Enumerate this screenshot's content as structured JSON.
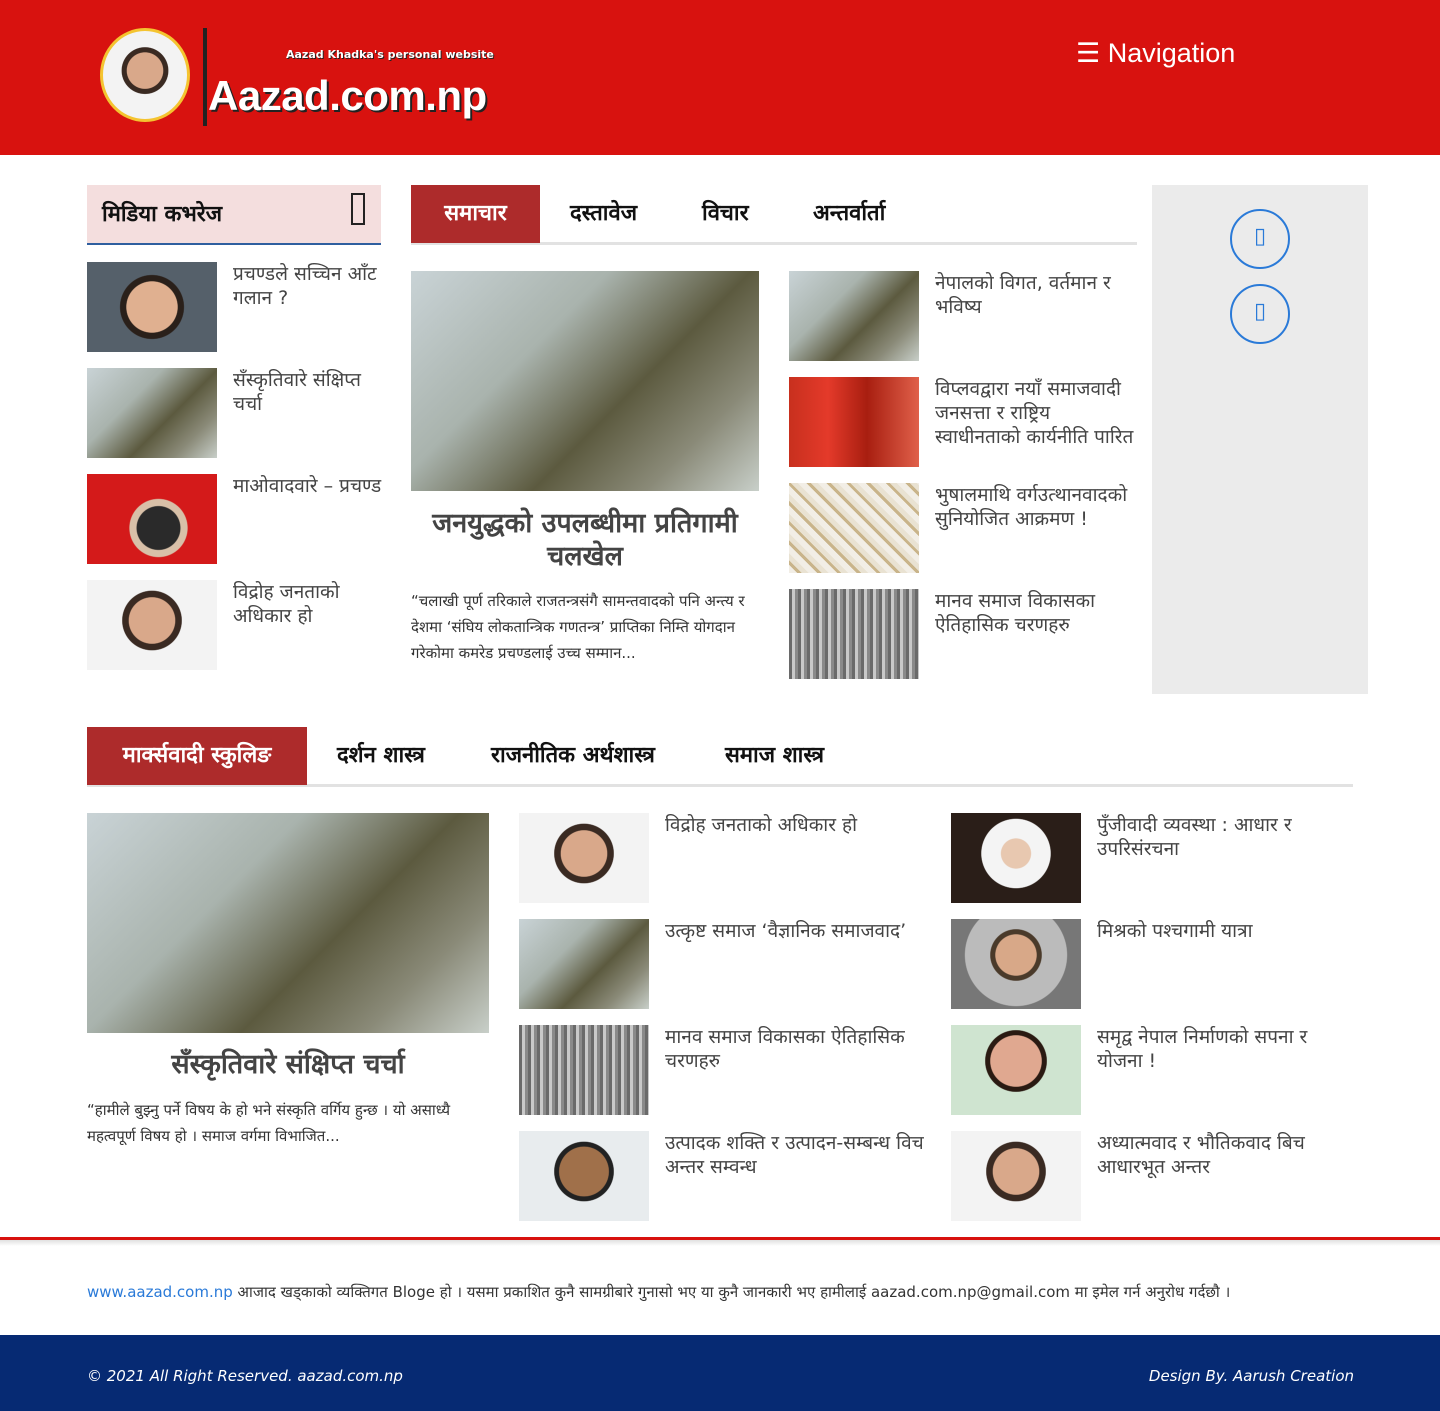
{
  "header": {
    "logo_subtitle": "Aazad Khadka's personal website",
    "logo_title": "Aazad.com.np",
    "nav_label": "☰ Navigation"
  },
  "sidebar": {
    "title": "मिडिया कभरेज",
    "items": [
      {
        "title": "प्रचण्डले सच्चिन आँट गलान ?"
      },
      {
        "title": "सँस्कृतिवारे संक्षिप्त चर्चा"
      },
      {
        "title": "माओवादवारे – प्रचण्ड"
      },
      {
        "title": "विद्रोह जनताको अधिकार हो"
      }
    ]
  },
  "news_tabs": {
    "tabs": [
      "समाचार",
      "दस्तावेज",
      "विचार",
      "अन्तर्वार्ता"
    ],
    "featured": {
      "title": "जनयुद्धको उपलब्धीमा प्रतिगामी चलखेल",
      "excerpt": "“चलाखी पूर्ण तरिकाले राजतन्त्रसंगै सामन्तवादको पनि अन्त्य र देशमा ‘संघिय लोकतान्त्रिक गणतन्त्र’ प्राप्तिका निम्ति योगदान गरेकोमा कमरेड प्रचण्डलाई उच्च सम्मान..."
    },
    "items": [
      {
        "title": "नेपालको विगत, वर्तमान र भविष्य"
      },
      {
        "title": "विप्लवद्वारा नयाँ समाजवादी जनसत्ता र राष्ट्रिय स्वाधीनताको कार्यनीति पारित"
      },
      {
        "title": "भुषालमाथि वर्गउत्थानवादको सुनियोजित आक्रमण !"
      },
      {
        "title": "मानव समाज विकासका ऐतिहासिक चरणहरु"
      }
    ]
  },
  "social": {
    "icons": [
      "facebook-icon",
      "twitter-icon"
    ],
    "glyph": "▯"
  },
  "schooling": {
    "tabs": [
      "मार्क्सवादी स्कुलिङ",
      "दर्शन शास्त्र",
      "राजनीतिक अर्थशास्त्र",
      "समाज शास्त्र"
    ],
    "featured": {
      "title": "सँस्कृतिवारे संक्षिप्त चर्चा",
      "excerpt": "“हामीले बुझ्नु पर्ने विषय के हो भने संस्कृति वर्गिय हुन्छ । यो असाध्यै महत्वपूर्ण विषय हो । समाज वर्गमा विभाजित..."
    },
    "col1": [
      {
        "title": "विद्रोह जनताको अधिकार हो"
      },
      {
        "title": "उत्कृष्ट समाज ‘वैज्ञानिक समाजवाद’"
      },
      {
        "title": "मानव समाज विकासका ऐतिहासिक चरणहरु"
      },
      {
        "title": "उत्पादक शक्ति र उत्पादन-सम्बन्ध विच अन्तर सम्वन्ध"
      }
    ],
    "col2": [
      {
        "title": "पुँजीवादी व्यवस्था : आधार र उपरिसंरचना"
      },
      {
        "title": "मिश्रको पश्चगामी यात्रा"
      },
      {
        "title": "समृद्व नेपाल निर्माणको सपना र योजना !"
      },
      {
        "title": "अध्यात्मवाद र भौतिकवाद बिच आधारभूत अन्तर"
      }
    ]
  },
  "footer": {
    "link": "www.aazad.com.np",
    "text": " आजाद खड्काको व्यक्तिगत Bloge हो । यसमा प्रकाशित कुनै सामग्रीबारे गुनासो भए या कुनै जानकारी भए हामीलाई aazad.com.np@gmail.com मा इमेल गर्न अनुरोध गर्दछौ ।",
    "copyright": "© 2021 All Right Reserved. aazad.com.np",
    "design_by": "Design By. Aarush Creation"
  },
  "colors": {
    "header_red": "#d8120f",
    "tab_active": "#ad2b2b",
    "footer_blue": "#062a73",
    "link_blue": "#2a7ad8"
  }
}
